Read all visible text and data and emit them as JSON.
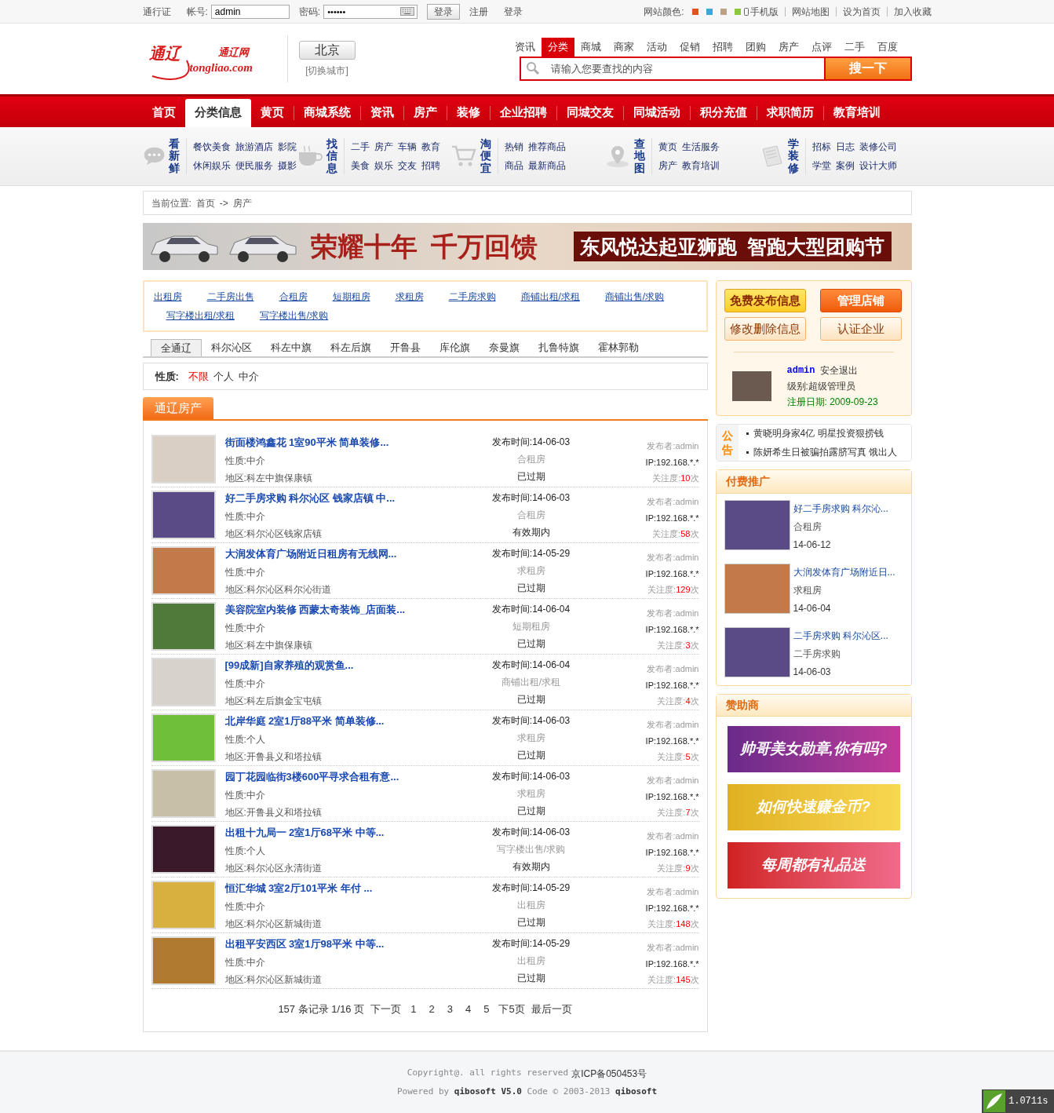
{
  "topbar": {
    "passport": "通行证",
    "account_label": "帐号:",
    "account": "admin",
    "password_label": "密码:",
    "password": "••••••",
    "login_button": "登录",
    "register": "注册",
    "login": "登录",
    "color_label": "网站颜色:",
    "colors": [
      {
        "color": "#e8501e"
      },
      {
        "color": "#3aa6dc"
      },
      {
        "color": "#b9a284"
      },
      {
        "color": "#8dc63f"
      }
    ],
    "links": [
      "手机版",
      "网站地图",
      "设为首页",
      "加入收藏"
    ]
  },
  "header": {
    "logo": {
      "main": "通辽",
      "sub": "通辽网",
      "domain": "tongliao.com"
    },
    "city": "北京",
    "switch_city": "[切换城市]",
    "search_tabs": [
      {
        "label": "资讯",
        "selected": false
      },
      {
        "label": "分类",
        "selected": true
      },
      {
        "label": "商城",
        "selected": false
      },
      {
        "label": "商家",
        "selected": false
      },
      {
        "label": "活动",
        "selected": false
      },
      {
        "label": "促销",
        "selected": false
      },
      {
        "label": "招聘",
        "selected": false
      },
      {
        "label": "团购",
        "selected": false
      },
      {
        "label": "房产",
        "selected": false
      },
      {
        "label": "点评",
        "selected": false
      },
      {
        "label": "二手",
        "selected": false
      },
      {
        "label": "百度",
        "selected": false
      }
    ],
    "search_placeholder": "请输入您要查找的内容",
    "search_button": "搜一下"
  },
  "nav": [
    {
      "label": "首页",
      "selected": false
    },
    {
      "label": "分类信息",
      "selected": true
    },
    {
      "label": "黄页",
      "selected": false
    },
    {
      "label": "商城系统",
      "selected": false
    },
    {
      "label": "资讯",
      "selected": false
    },
    {
      "label": "房产",
      "selected": false
    },
    {
      "label": "装修",
      "selected": false
    },
    {
      "label": "企业招聘",
      "selected": false
    },
    {
      "label": "同城交友",
      "selected": false
    },
    {
      "label": "同城活动",
      "selected": false
    },
    {
      "label": "积分充值",
      "selected": false
    },
    {
      "label": "求职简历",
      "selected": false
    },
    {
      "label": "教育培训",
      "selected": false
    }
  ],
  "subnav": [
    {
      "title": "看新鲜",
      "rows": [
        [
          "餐饮美食",
          "旅游酒店",
          "影院"
        ],
        [
          "休闲娱乐",
          "便民服务",
          "摄影"
        ]
      ]
    },
    {
      "title": "找信息",
      "rows": [
        [
          "二手",
          "房产",
          "车辆",
          "教育"
        ],
        [
          "美食",
          "娱乐",
          "交友",
          "招聘"
        ]
      ]
    },
    {
      "title": "淘便宜",
      "rows": [
        [
          "热销",
          "推荐商品"
        ],
        [
          "商品",
          "最新商品"
        ]
      ]
    },
    {
      "title": "查地图",
      "rows": [
        [
          "黄页",
          "生活服务"
        ],
        [
          "房产",
          "教育培训"
        ]
      ]
    },
    {
      "title": "学装修",
      "rows": [
        [
          "招标",
          "日志",
          "装修公司"
        ],
        [
          "学堂",
          "案例",
          "设计大师"
        ]
      ]
    }
  ],
  "breadcrumb": {
    "label": "当前位置:",
    "items": [
      "首页",
      "房产"
    ],
    "separator": "->"
  },
  "banner": {
    "slogan": "荣耀十年  千万回馈",
    "caption": "东风悦达起亚狮跑  智跑大型团购节"
  },
  "categories": [
    "出租房",
    "二手房出售",
    "合租房",
    "短期租房",
    "求租房",
    "二手房求购",
    "商铺出租/求租",
    "商铺出售/求购",
    "写字楼出租/求租",
    "写字楼出售/求购"
  ],
  "regions": [
    {
      "label": "全通辽",
      "selected": true
    },
    {
      "label": "科尔沁区",
      "selected": false
    },
    {
      "label": "科左中旗",
      "selected": false
    },
    {
      "label": "科左后旗",
      "selected": false
    },
    {
      "label": "开鲁县",
      "selected": false
    },
    {
      "label": "库伦旗",
      "selected": false
    },
    {
      "label": "奈曼旗",
      "selected": false
    },
    {
      "label": "扎鲁特旗",
      "selected": false
    },
    {
      "label": "霍林郭勒",
      "selected": false
    }
  ],
  "nature_filter": {
    "label": "性质:",
    "options": [
      {
        "label": "不限",
        "selected": true
      },
      {
        "label": "个人",
        "selected": false
      },
      {
        "label": "中介",
        "selected": false
      }
    ]
  },
  "listing": {
    "title": "通辽房产",
    "rows": [
      {
        "title": "街面楼鸿鑫花 1室90平米 简单装修...",
        "nature": "性质:中介",
        "area": "地区:科左中旗保康镇",
        "time": "发布时间:14-06-03",
        "category": "合租房",
        "status": "已过期",
        "poster": "发布者:admin",
        "ip": "IP:192.168.*.*",
        "views_label": "关注度:",
        "views": "10",
        "views_unit": "次"
      },
      {
        "title": "好二手房求购 科尔沁区 钱家店镇 中...",
        "nature": "性质:中介",
        "area": "地区:科尔沁区钱家店镇",
        "time": "发布时间:14-06-03",
        "category": "合租房",
        "status": "有效期内",
        "poster": "发布者:admin",
        "ip": "IP:192.168.*.*",
        "views_label": "关注度:",
        "views": "58",
        "views_unit": "次"
      },
      {
        "title": "大润发体育广场附近日租房有无线网...",
        "nature": "性质:中介",
        "area": "地区:科尔沁区科尔沁街道",
        "time": "发布时间:14-05-29",
        "category": "求租房",
        "status": "已过期",
        "poster": "发布者:admin",
        "ip": "IP:192.168.*.*",
        "views_label": "关注度:",
        "views": "129",
        "views_unit": "次"
      },
      {
        "title": "美容院室内装修 西蒙太奇装饰_店面装...",
        "nature": "性质:中介",
        "area": "地区:科左中旗保康镇",
        "time": "发布时间:14-06-04",
        "category": "短期租房",
        "status": "已过期",
        "poster": "发布者:admin",
        "ip": "IP:192.168.*.*",
        "views_label": "关注度:",
        "views": "3",
        "views_unit": "次"
      },
      {
        "title": "[99成新]自家养殖的观赏鱼...",
        "nature": "性质:中介",
        "area": "地区:科左后旗金宝屯镇",
        "time": "发布时间:14-06-04",
        "category": "商铺出租/求租",
        "status": "已过期",
        "poster": "发布者:admin",
        "ip": "IP:192.168.*.*",
        "views_label": "关注度:",
        "views": "4",
        "views_unit": "次"
      },
      {
        "title": "北岸华庭 2室1厅88平米 简单装修...",
        "nature": "性质:个人",
        "area": "地区:开鲁县义和塔拉镇",
        "time": "发布时间:14-06-03",
        "category": "求租房",
        "status": "已过期",
        "poster": "发布者:admin",
        "ip": "IP:192.168.*.*",
        "views_label": "关注度:",
        "views": "5",
        "views_unit": "次"
      },
      {
        "title": "园丁花园临街3楼600平寻求合租有意...",
        "nature": "性质:中介",
        "area": "地区:开鲁县义和塔拉镇",
        "time": "发布时间:14-06-03",
        "category": "求租房",
        "status": "已过期",
        "poster": "发布者:admin",
        "ip": "IP:192.168.*.*",
        "views_label": "关注度:",
        "views": "7",
        "views_unit": "次"
      },
      {
        "title": "出租十九局一 2室1厅68平米 中等...",
        "nature": "性质:个人",
        "area": "地区:科尔沁区永清街道",
        "time": "发布时间:14-06-03",
        "category": "写字楼出售/求购",
        "status": "有效期内",
        "poster": "发布者:admin",
        "ip": "IP:192.168.*.*",
        "views_label": "关注度:",
        "views": "9",
        "views_unit": "次"
      },
      {
        "title": "恒汇华城 3室2厅101平米 年付 ...",
        "nature": "性质:中介",
        "area": "地区:科尔沁区新城街道",
        "time": "发布时间:14-05-29",
        "category": "出租房",
        "status": "已过期",
        "poster": "发布者:admin",
        "ip": "IP:192.168.*.*",
        "views_label": "关注度:",
        "views": "148",
        "views_unit": "次"
      },
      {
        "title": "出租平安西区 3室1厅98平米 中等...",
        "nature": "性质:中介",
        "area": "地区:科尔沁区新城街道",
        "time": "发布时间:14-05-29",
        "category": "出租房",
        "status": "已过期",
        "poster": "发布者:admin",
        "ip": "IP:192.168.*.*",
        "views_label": "关注度:",
        "views": "145",
        "views_unit": "次"
      }
    ]
  },
  "pagination": {
    "summary": "157 条记录 1/16 页",
    "next": "下一页",
    "pages": [
      "1",
      "2",
      "3",
      "4",
      "5"
    ],
    "next_five": "下5页",
    "last": "最后一页"
  },
  "sidebar": {
    "buttons": [
      {
        "label": "免费发布信息",
        "kind": "accent"
      },
      {
        "label": "管理店铺",
        "kind": "strong"
      },
      {
        "label": "修改删除信息",
        "kind": "plain"
      },
      {
        "label": "认证企业",
        "kind": "plain"
      }
    ],
    "user": {
      "name": "admin",
      "logout": "安全退出",
      "level": "级别:超级管理员",
      "registered": "注册日期: 2009-09-23"
    },
    "notice": {
      "label": "公告",
      "items": [
        "黄晓明身家4亿 明星投资狠捞钱",
        "陈妍希生日被骗拍露脐写真 饿出人"
      ]
    },
    "promotion": {
      "title": "付费推广",
      "items": [
        {
          "title": "好二手房求购 科尔沁...",
          "category": "合租房",
          "date": "14-06-12"
        },
        {
          "title": "大润发体育广场附近日...",
          "category": "求租房",
          "date": "14-06-04"
        },
        {
          "title": "二手房求购 科尔沁区...",
          "category": "二手房求购",
          "date": "14-06-03"
        }
      ]
    },
    "sponsors": {
      "title": "赞助商",
      "ads": [
        "帅哥美女勋章,你有吗?",
        "如何快速赚金币?",
        "每周都有礼品送"
      ]
    }
  },
  "footer": {
    "copyright": "Copyright@. all rights reserved",
    "icp": "京ICP备050453号",
    "powered": "Powered by **qibosoft V5.0** Code © 2003-2013 **qibosoft**"
  },
  "timer": "1.0711s"
}
